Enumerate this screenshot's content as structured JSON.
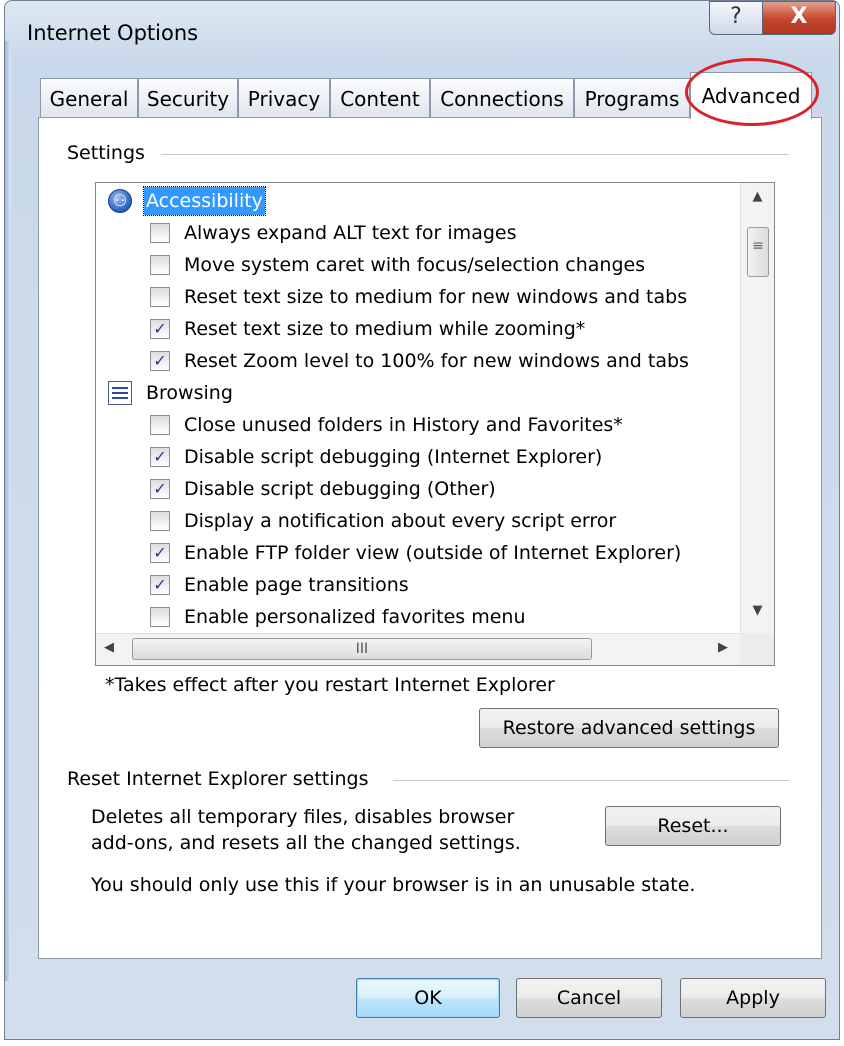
{
  "window": {
    "title": "Internet Options",
    "help_glyph": "?",
    "close_glyph": "X"
  },
  "tabs": [
    {
      "label": "General"
    },
    {
      "label": "Security"
    },
    {
      "label": "Privacy"
    },
    {
      "label": "Content"
    },
    {
      "label": "Connections"
    },
    {
      "label": "Programs"
    },
    {
      "label": "Advanced"
    }
  ],
  "active_tab": "Advanced",
  "settings": {
    "group_label": "Settings",
    "categories": [
      {
        "name": "Accessibility",
        "icon": "accessibility-icon",
        "icon_glyph": "⚇",
        "selected": true,
        "items": [
          {
            "label": "Always expand ALT text for images",
            "checked": false,
            "mark": ""
          },
          {
            "label": "Move system caret with focus/selection changes",
            "checked": false,
            "mark": ""
          },
          {
            "label": "Reset text size to medium for new windows and tabs",
            "checked": false,
            "mark": ""
          },
          {
            "label": "Reset text size to medium while zooming*",
            "checked": true,
            "mark": "✓"
          },
          {
            "label": "Reset Zoom level to 100% for new windows and tabs",
            "checked": true,
            "mark": "✓"
          }
        ]
      },
      {
        "name": "Browsing",
        "icon": "browsing-icon",
        "selected": false,
        "items": [
          {
            "label": "Close unused folders in History and Favorites*",
            "checked": false,
            "mark": ""
          },
          {
            "label": "Disable script debugging (Internet Explorer)",
            "checked": true,
            "mark": "✓"
          },
          {
            "label": "Disable script debugging (Other)",
            "checked": true,
            "mark": "✓"
          },
          {
            "label": "Display a notification about every script error",
            "checked": false,
            "mark": ""
          },
          {
            "label": "Enable FTP folder view (outside of Internet Explorer)",
            "checked": true,
            "mark": "✓"
          },
          {
            "label": "Enable page transitions",
            "checked": true,
            "mark": "✓"
          },
          {
            "label": "Enable personalized favorites menu",
            "checked": false,
            "mark": ""
          }
        ]
      }
    ],
    "scroll": {
      "up_arrow": "▲",
      "down_arrow": "▼",
      "left_arrow": "◀",
      "right_arrow": "▶",
      "thumb_grip": "III",
      "vthumb_grip": "≡"
    },
    "footnote": "*Takes effect after you restart Internet Explorer",
    "restore_button": "Restore advanced settings"
  },
  "reset_group": {
    "group_label": "Reset Internet Explorer settings",
    "description_line1": "Deletes all temporary files, disables browser",
    "description_line2": "add-ons, and resets all the changed settings.",
    "reset_button": "Reset...",
    "warning": "You should only use this if your browser is in an unusable state."
  },
  "footer": {
    "ok": "OK",
    "cancel": "Cancel",
    "apply": "Apply"
  },
  "colors": {
    "highlight_ellipse": "#d8232a",
    "selection": "#3399ff"
  }
}
